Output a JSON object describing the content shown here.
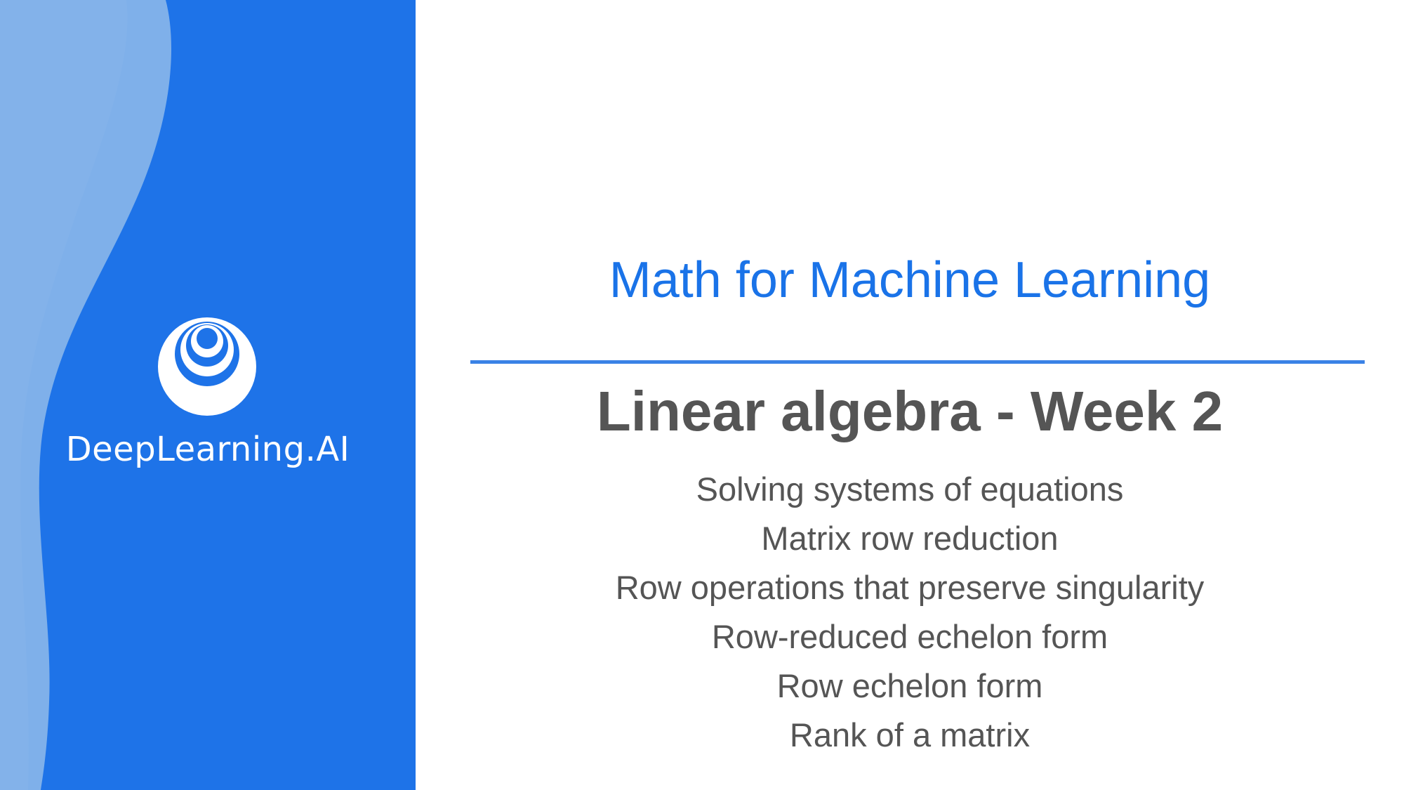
{
  "brand": {
    "name": "DeepLearning.AI",
    "panel_color": "#1e73e8",
    "wave_color": "#7fb0ea"
  },
  "slide": {
    "course_title": "Math for Machine Learning",
    "week_title": "Linear algebra - Week 2",
    "topics": [
      "Solving systems of equations",
      "Matrix row reduction",
      "Row operations that preserve singularity",
      "Row-reduced echelon form",
      "Row echelon form",
      "Rank of a matrix"
    ],
    "accent_color": "#1a73e8",
    "text_color": "#555555"
  }
}
